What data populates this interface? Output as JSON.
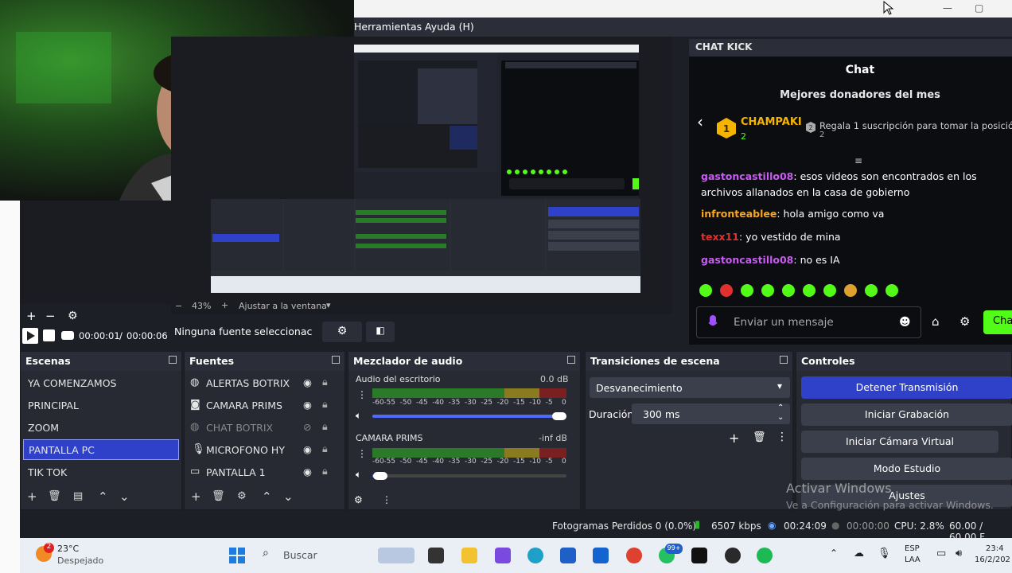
{
  "menu": {
    "tools": "Herramientas",
    "help": "Ayuda (H)"
  },
  "chat": {
    "dock_title": "CHAT KICK",
    "title": "Chat",
    "donors_title": "Mejores donadores del mes",
    "top_donor": {
      "rank": "1",
      "name": "CHAMPAKI",
      "count": "2"
    },
    "second": {
      "rank": "2",
      "text": "Regala 1 suscripción para tomar la posición",
      "count": "2"
    },
    "messages": [
      {
        "user": "gastoncastillo08",
        "text": ": esos videos son encontrados en los archivos allanados en la casa de gobierno",
        "color": "#c85bf0"
      },
      {
        "user": "infronteablee",
        "text": ": hola amigo como va",
        "color": "#f5a623"
      },
      {
        "user": "texx11",
        "text": ": yo vestido de mina",
        "color": "#e03030"
      },
      {
        "user": "gastoncastillo08",
        "text": ": no es IA",
        "color": "#c85bf0"
      }
    ],
    "input_placeholder": "Enviar un mensaje",
    "send_label": "Cha"
  },
  "preview": {
    "zoom": "43%",
    "fit_label": "Ajustar a la ventana"
  },
  "media": {
    "elapsed": "00:00:01",
    "separator": "/",
    "duration": "00:00:06"
  },
  "no_source": "Ninguna fuente seleccionac",
  "scenes": {
    "title": "Escenas",
    "items": [
      "YA COMENZAMOS",
      "PRINCIPAL",
      "ZOOM",
      "PANTALLA PC",
      "TIK TOK"
    ],
    "selected": 3
  },
  "sources": {
    "title": "Fuentes",
    "items": [
      {
        "name": "ALERTAS BOTRIX",
        "icon": "globe-icon",
        "visible": true
      },
      {
        "name": "CAMARA PRIMS",
        "icon": "camera-icon",
        "visible": true
      },
      {
        "name": "CHAT BOTRIX",
        "icon": "globe-icon",
        "visible": false
      },
      {
        "name": "MICROFONO HY",
        "icon": "microphone-icon",
        "visible": true
      },
      {
        "name": "PANTALLA 1",
        "icon": "monitor-icon",
        "visible": true
      }
    ]
  },
  "mixer": {
    "title": "Mezclador de audio",
    "channels": [
      {
        "name": "Audio del escritorio",
        "level": "0.0 dB",
        "volume": 0.98
      },
      {
        "name": "CAMARA PRIMS",
        "level": "-inf dB",
        "volume": 0.04
      }
    ],
    "scale": [
      "-60",
      "-55",
      "-50",
      "-45",
      "-40",
      "-35",
      "-30",
      "-25",
      "-20",
      "-15",
      "-10",
      "-5",
      "0"
    ]
  },
  "transitions": {
    "title": "Transiciones de escena",
    "selected": "Desvanecimiento",
    "duration_label": "Duración",
    "duration_value": "300 ms"
  },
  "controls": {
    "title": "Controles",
    "stop_stream": "Detener Transmisión",
    "start_record": "Iniciar Grabación",
    "start_vcam": "Iniciar Cámara Virtual",
    "studio_mode": "Modo Estudio",
    "settings": "Ajustes"
  },
  "watermark": {
    "line1": "Activar Windows",
    "line2": "Ve a Configuración para activar Windows."
  },
  "status": {
    "dropped": "Fotogramas Perdidos 0 (0.0%)",
    "bitrate": "6507 kbps",
    "stream_time": "00:24:09",
    "rec_time": "00:00:00",
    "cpu": "CPU: 2.8%",
    "fps": "60.00 / 60.00 F"
  },
  "taskbar": {
    "weather_temp": "23°C",
    "weather_desc": "Despejado",
    "weather_badge": "2",
    "search": "Buscar",
    "whatsapp_badge": "99+",
    "lang1": "ESP",
    "lang2": "LAA",
    "time": "23:4",
    "date": "16/2/202"
  },
  "colors": {
    "accent": "#2f41c9",
    "kick_green": "#53fc18",
    "panel": "#272a33",
    "header": "#2b2e38"
  }
}
